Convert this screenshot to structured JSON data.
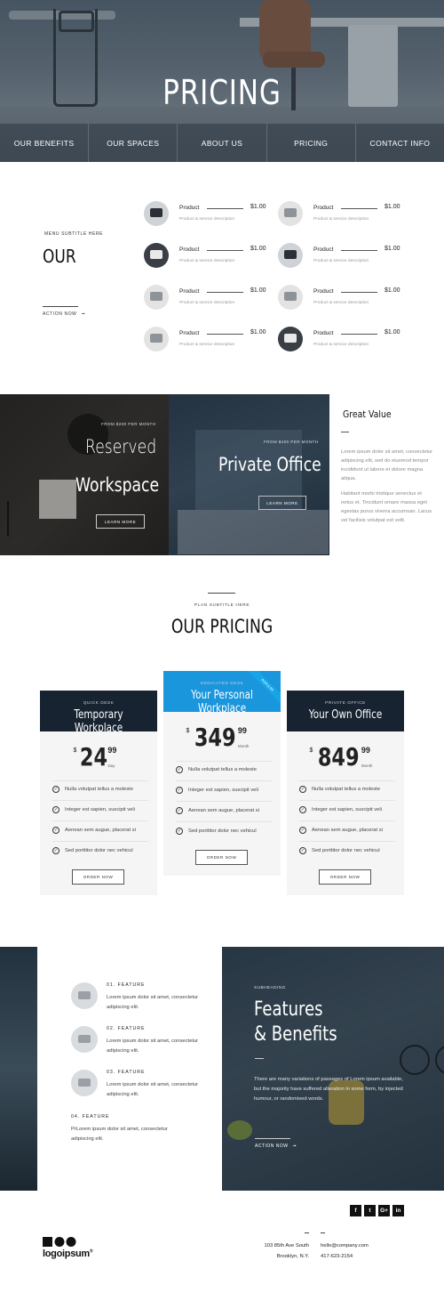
{
  "hero": {
    "title": "PRICING"
  },
  "nav": [
    "OUR BENEFITS",
    "OUR SPACES",
    "ABOUT US",
    "PRICING",
    "CONTACT INFO"
  ],
  "menu": {
    "subtitle": "MENU SUBTITLE HERE",
    "title": "OUR",
    "action": "ACTION NOW",
    "products": [
      {
        "name": "Product",
        "price": "$1.00",
        "desc": "Product & service description",
        "thumb": "desk-lamp-icon"
      },
      {
        "name": "Product",
        "price": "$1.00",
        "desc": "Product & service description",
        "thumb": "desk-icon"
      },
      {
        "name": "Product",
        "price": "$1.00",
        "desc": "Product & service description",
        "thumb": "laptop-icon"
      },
      {
        "name": "Product",
        "price": "$1.00",
        "desc": "Product & service description",
        "thumb": "chair-icon"
      },
      {
        "name": "Product",
        "price": "$1.00",
        "desc": "Product & service description",
        "thumb": "desk-icon"
      },
      {
        "name": "Product",
        "price": "$1.00",
        "desc": "Product & service description",
        "thumb": "laptop-icon"
      },
      {
        "name": "Product",
        "price": "$1.00",
        "desc": "Product & service description",
        "thumb": "laptop-icon"
      },
      {
        "name": "Product",
        "price": "$1.00",
        "desc": "Product & service description",
        "thumb": "laptop-icon"
      }
    ]
  },
  "workspace": {
    "card1": {
      "from": "FROM $200 PER MONTH",
      "title_line1": "Reserved",
      "title_line2": "Workspace",
      "button": "LEARN MORE"
    },
    "card2": {
      "from": "FROM $400 PER MONTH",
      "title": "Private Office",
      "button": "LEARN MORE"
    },
    "value": {
      "title": "Great Value",
      "p1": "Lorem ipsum dolor sit amet, consectetur adipiscing elit, sed do eiusmod tempor incididunt ut labore et dolore magna aliqua.",
      "p2": "Habitant morbi tristique senectus et netus et. Tincidunt ornare massa eget egestas purus viverra accumsan. Lacus vel facilisis volutpat est velit."
    }
  },
  "pricing": {
    "subtitle": "PLAN SUBTITLE HERE",
    "title": "OUR PRICING",
    "plans": [
      {
        "kicker": "QUICK DESK",
        "name": "Temporary Workplace",
        "currency": "$",
        "amount": "24",
        "cents": "99",
        "period": "Day",
        "features": [
          "Nulla volutpat tellus a moleste",
          "Integer est sapien, suscipit veli",
          "Aenean sem augue, placerat si",
          "Sed porttitor dolor nec vehicul"
        ],
        "button": "ORDER NOW"
      },
      {
        "kicker": "DEDICATED DESK",
        "name": "Your Personal Workplace",
        "ribbon": "POPULAR",
        "currency": "$",
        "amount": "349",
        "cents": "99",
        "period": "Month",
        "features": [
          "Nulla volutpat tellus a moleste",
          "Integer est sapien, suscipit veli",
          "Aenean sem augue, placerat si",
          "Sed porttitor dolor nec vehicul"
        ],
        "button": "ORDER NOW"
      },
      {
        "kicker": "PRIVATE OFFICE",
        "name": "Your Own Office",
        "currency": "$",
        "amount": "849",
        "cents": "99",
        "period": "Month",
        "features": [
          "Nulla volutpat tellus a moleste",
          "Integer est sapien, suscipit veli",
          "Aenean sem augue, placerat si",
          "Sed porttitor dolor nec vehicul"
        ],
        "button": "ORDER NOW"
      }
    ]
  },
  "features": {
    "items": [
      {
        "label": "01. FEATURE",
        "text": "Lorem ipsum dolor sit amet, consectetur adipiscing elit."
      },
      {
        "label": "02. FEATURE",
        "text": "Lorem ipsum dolor sit amet, consectetur adipiscing elit."
      },
      {
        "label": "03. FEATURE",
        "text": "Lorem ipsum dolor sit amet, consectetur adipiscing elit."
      }
    ],
    "item4": {
      "label": "04. FEATURE",
      "text": "PrLorem ipsum dolor sit amet, consectetur adipiscing elit."
    },
    "panel": {
      "subheading": "SUBHEADING",
      "title_line1": "Features",
      "title_line2": "& Benefits",
      "body": "There are many variations of passages of Lorem ipsum available, but the majority have suffered alteration in some form, by injected humour, or randomised words.",
      "action": "ACTION NOW"
    }
  },
  "footer": {
    "social": [
      "f",
      "t",
      "G+",
      "in"
    ],
    "logo": "logoipsum",
    "logo_mark": "®",
    "address_line1": "103 85th Ave South",
    "address_line2": "Brooklyn, N.Y.",
    "email": "hello@company.com",
    "phone": "417-623-2154"
  }
}
